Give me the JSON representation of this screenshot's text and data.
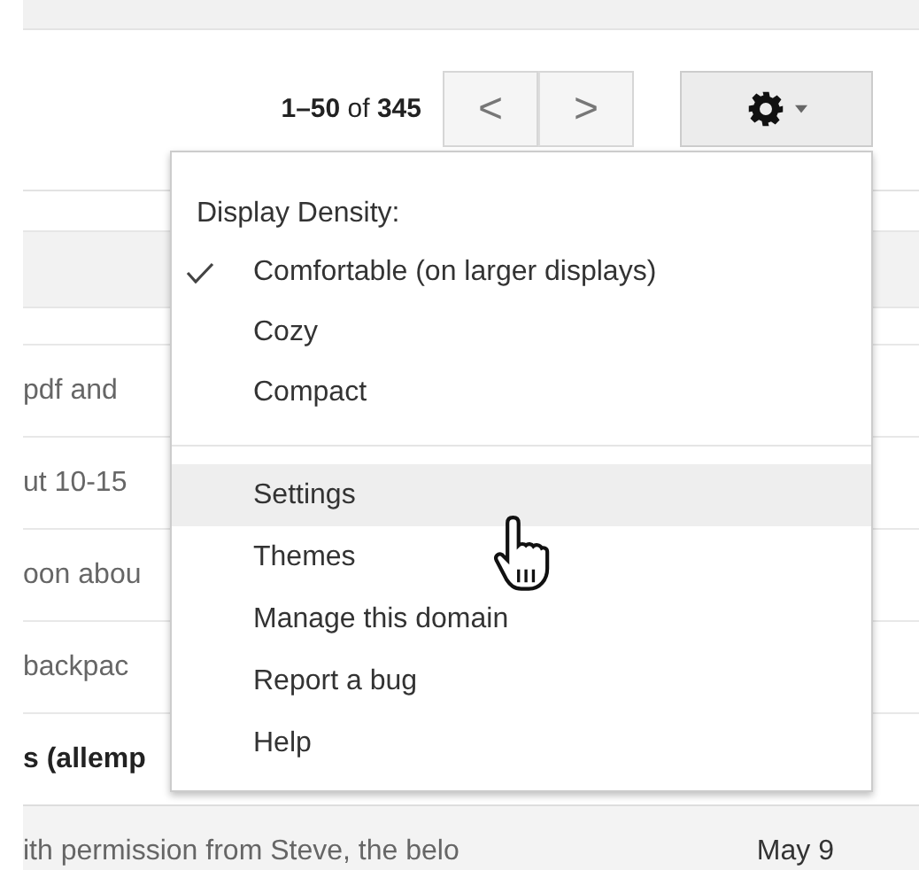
{
  "pager": {
    "range": "1–50",
    "of": "of",
    "total": "345",
    "prev": "<",
    "next": ">"
  },
  "settings_menu": {
    "items": [
      {
        "kind": "header",
        "label": "Display Density:"
      },
      {
        "kind": "option",
        "label": "Comfortable (on larger displays)",
        "selected": true
      },
      {
        "kind": "option",
        "label": "Cozy",
        "selected": false
      },
      {
        "kind": "option",
        "label": "Compact",
        "selected": false
      },
      {
        "kind": "divider"
      },
      {
        "kind": "action",
        "label": "Settings",
        "highlighted": true
      },
      {
        "kind": "action",
        "label": "Themes",
        "highlighted": false
      },
      {
        "kind": "action",
        "label": "Manage this domain",
        "highlighted": false
      },
      {
        "kind": "action",
        "label": "Report a bug",
        "highlighted": false
      },
      {
        "kind": "action",
        "label": "Help",
        "highlighted": false
      }
    ]
  },
  "messages": [
    {
      "snippet": "pdf and",
      "unread": false
    },
    {
      "snippet": "ut 10-15",
      "unread": false
    },
    {
      "snippet": "oon abou",
      "unread": false
    },
    {
      "snippet": "backpac",
      "unread": false
    },
    {
      "snippet": "s (allemp",
      "unread": true
    },
    {
      "snippet": "ith permission from Steve, the belo",
      "date": "May 9",
      "unread": false
    }
  ]
}
